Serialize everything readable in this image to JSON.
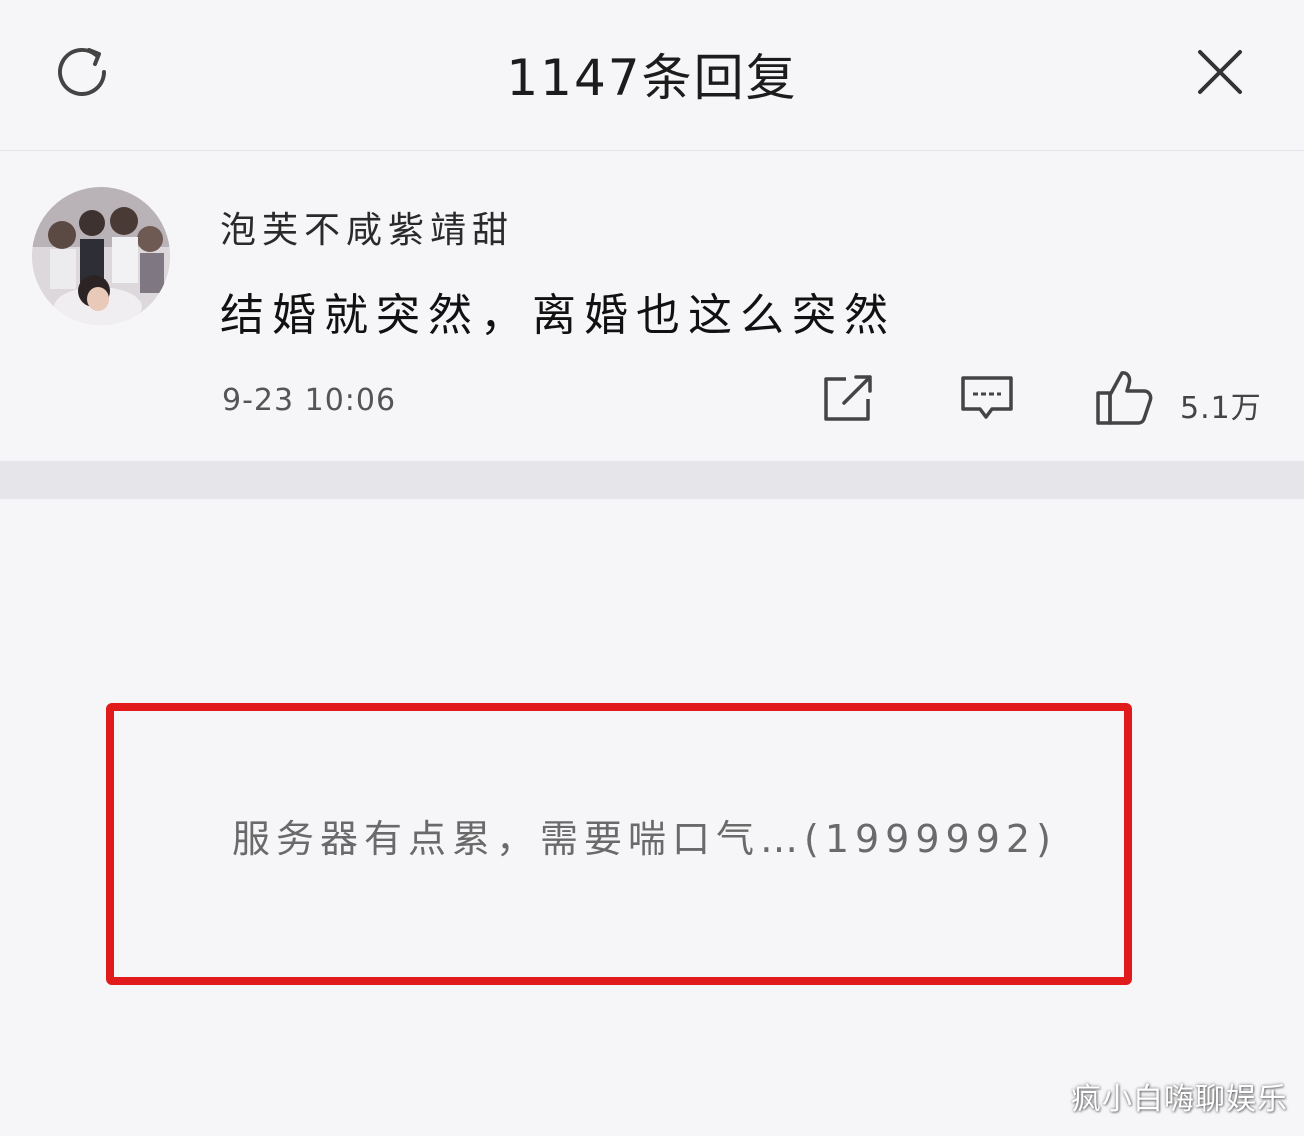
{
  "header": {
    "title": "1147条回复",
    "refresh_icon": "refresh-icon",
    "close_icon": "close-icon"
  },
  "comment": {
    "username": "泡芙不咸紫靖甜",
    "text": "结婚就突然，离婚也这么突然",
    "timestamp": "9-23 10:06",
    "like_count": "5.1万",
    "actions": {
      "share_icon": "share-icon",
      "reply_icon": "comment-icon",
      "like_icon": "thumbs-up-icon"
    }
  },
  "replies": {
    "error_message": "服务器有点累，需要喘口气…(1999992)"
  },
  "watermark": "疯小白嗨聊娱乐",
  "colors": {
    "background": "#f6f5f8",
    "divider": "#e6e5e9",
    "highlight_border": "#e11b1b",
    "error_text": "#6a6a6a"
  }
}
